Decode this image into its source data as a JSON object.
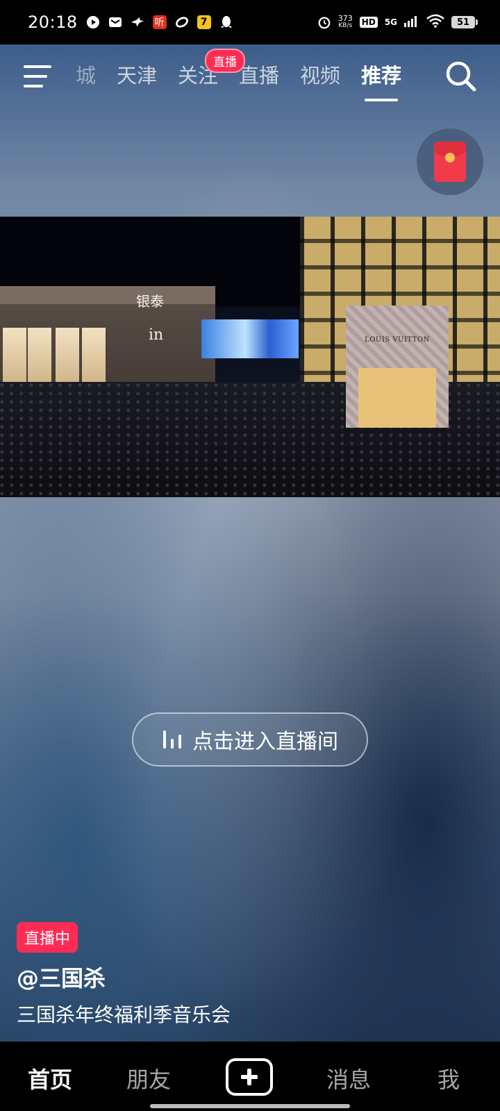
{
  "status_bar": {
    "time": "20:18",
    "net_speed_value": "373",
    "net_speed_unit": "KB/s",
    "hd": "HD",
    "network": "5G",
    "battery": "51",
    "icons": [
      "play-circle-icon",
      "mail-icon",
      "bird-icon",
      "ting-app-icon",
      "loop-app-icon",
      "seven-app-icon",
      "qq-icon",
      "alarm-icon",
      "signal-icon",
      "wifi-icon"
    ],
    "ting_label": "听"
  },
  "top_nav": {
    "tabs": [
      "城",
      "天津",
      "关注",
      "直播",
      "视频",
      "推荐"
    ],
    "active_tab": "推荐",
    "live_badge": "直播"
  },
  "live": {
    "enter_button": "点击进入直播间",
    "status_tag": "直播中",
    "author": "@三国杀",
    "description": "三国杀年终福利季音乐会"
  },
  "video_scene": {
    "sign_yintai": "银泰",
    "sign_in": "in",
    "louis_vuitton": "LOUIS VUITTON"
  },
  "bottom_nav": {
    "items": [
      "首页",
      "朋友",
      "消息",
      "我"
    ],
    "active": "首页"
  },
  "colors": {
    "accent_red": "#fe2c55",
    "background": "#000000"
  }
}
